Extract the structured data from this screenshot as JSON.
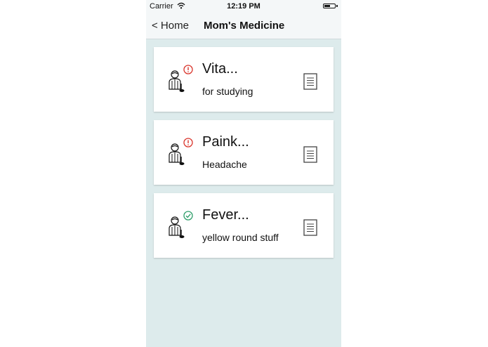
{
  "status_bar": {
    "carrier": "Carrier",
    "time": "12:19 PM",
    "battery_level": 0.6
  },
  "nav": {
    "back_label": "< Home",
    "title": "Mom's Medicine"
  },
  "colors": {
    "alert": "#d9342b",
    "ok": "#2e9e6a",
    "background": "#ddebec"
  },
  "medicines": [
    {
      "name": "Vita...",
      "note": "for studying",
      "status": "alert",
      "status_icon": "alert-circle-icon"
    },
    {
      "name": "Paink...",
      "note": "Headache",
      "status": "alert",
      "status_icon": "alert-circle-icon"
    },
    {
      "name": "Fever...",
      "note": "yellow round stuff",
      "status": "ok",
      "status_icon": "check-circle-icon"
    }
  ]
}
